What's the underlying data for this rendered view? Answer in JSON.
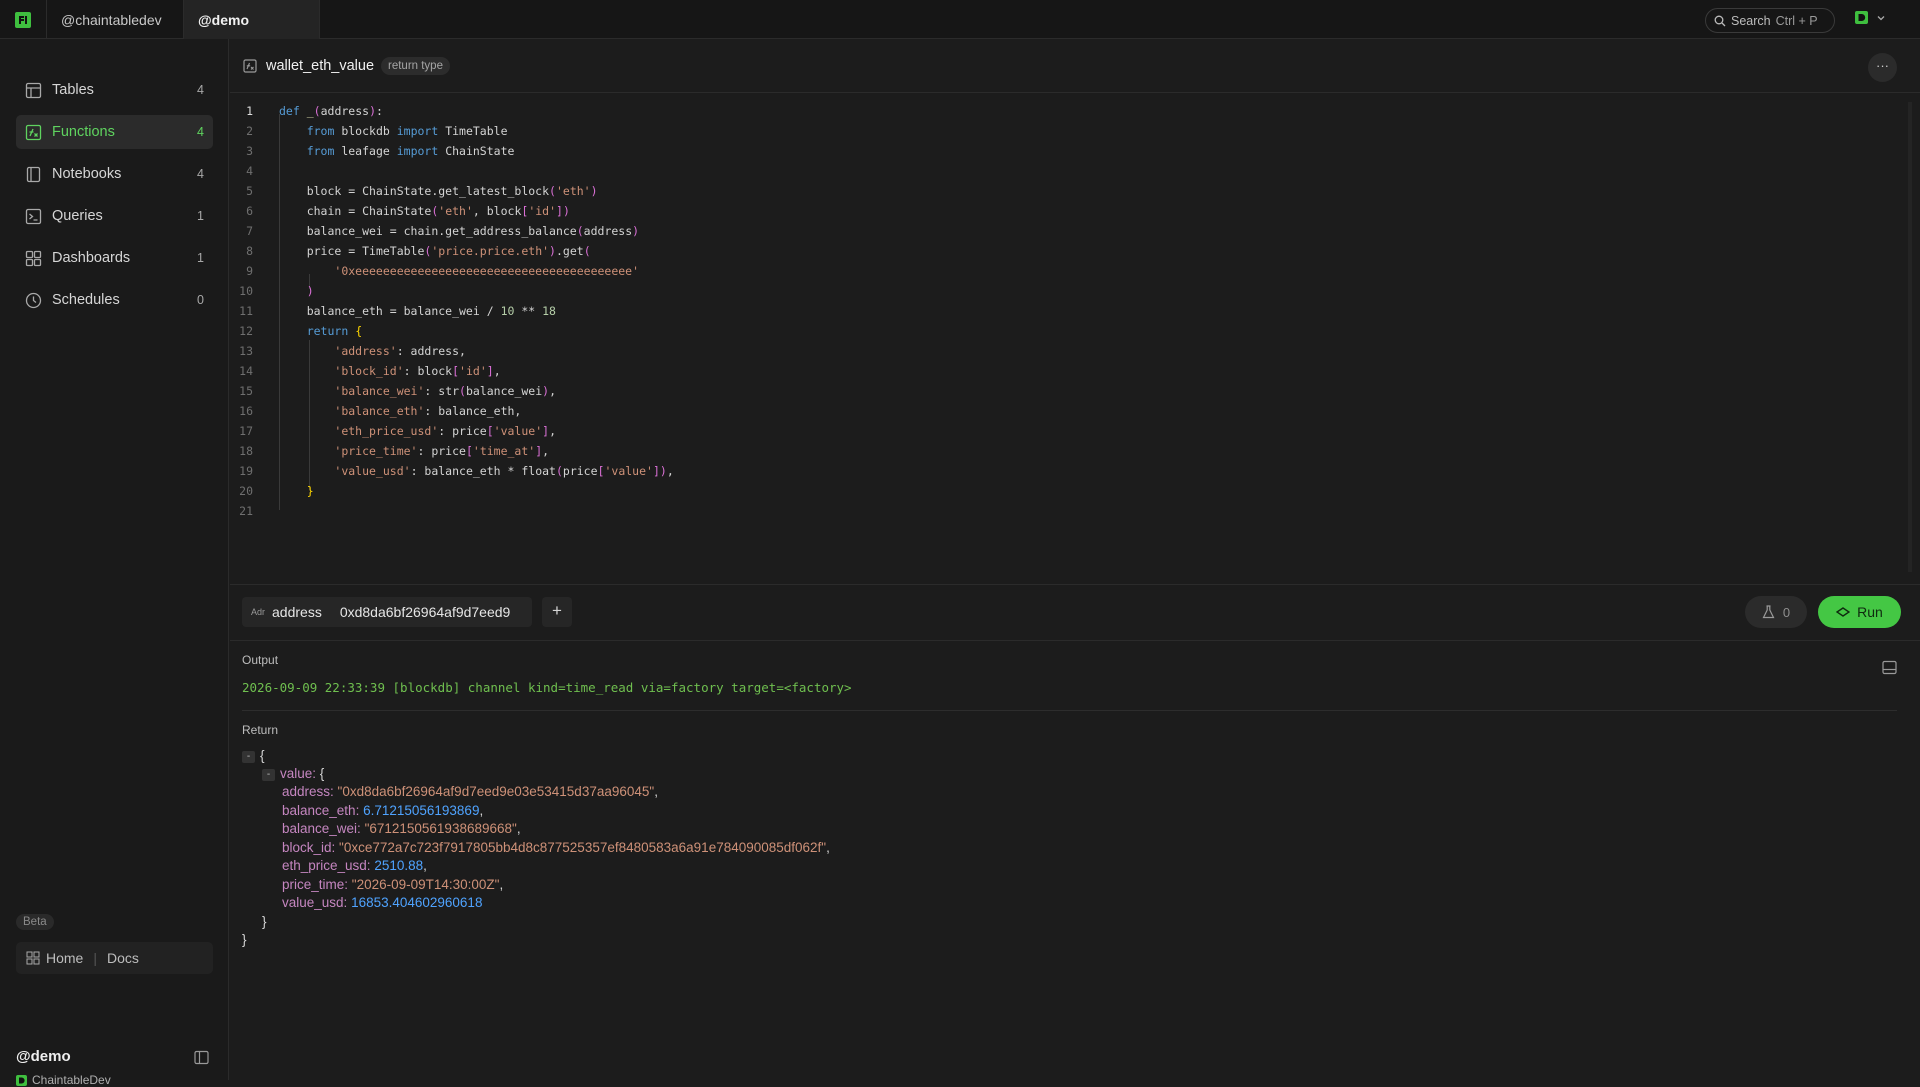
{
  "workspaces": [
    {
      "label": "@chaintabledev"
    },
    {
      "label": "@demo"
    }
  ],
  "search": {
    "label": "Search",
    "shortcut": "Ctrl + P"
  },
  "profile": {
    "initial": "D"
  },
  "sidebar": {
    "items": [
      {
        "label": "Tables",
        "count": "4",
        "icon": "table-icon"
      },
      {
        "label": "Functions",
        "count": "4",
        "icon": "function-icon",
        "active": true
      },
      {
        "label": "Notebooks",
        "count": "4",
        "icon": "notebook-icon"
      },
      {
        "label": "Queries",
        "count": "1",
        "icon": "terminal-icon"
      },
      {
        "label": "Dashboards",
        "count": "1",
        "icon": "dashboard-icon"
      },
      {
        "label": "Schedules",
        "count": "0",
        "icon": "clock-icon"
      }
    ],
    "beta": "Beta",
    "links": {
      "home": "Home",
      "docs": "Docs"
    },
    "account": {
      "name": "@demo",
      "org": "ChaintableDev"
    }
  },
  "function": {
    "name": "wallet_eth_value",
    "badge": "return type",
    "more": "···"
  },
  "editor": {
    "active_line": "1",
    "lines": [
      "def _(address):",
      "    from blockdb import TimeTable",
      "    from leafage import ChainState",
      "",
      "    block = ChainState.get_latest_block('eth')",
      "    chain = ChainState('eth', block['id'])",
      "    balance_wei = chain.get_address_balance(address)",
      "    price = TimeTable('price.price.eth').get(",
      "        '0xeeeeeeeeeeeeeeeeeeeeeeeeeeeeeeeeeeeeeeee'",
      "    )",
      "    balance_eth = balance_wei / 10 ** 18",
      "    return {",
      "        'address': address,",
      "        'block_id': block['id'],",
      "        'balance_wei': str(balance_wei),",
      "        'balance_eth': balance_eth,",
      "        'eth_price_usd': price['value'],",
      "        'price_time': price['time_at'],",
      "        'value_usd': balance_eth * float(price['value']),",
      "    }",
      ""
    ]
  },
  "params": {
    "tag": "Adr",
    "name": "address",
    "value": "0xd8da6bf26964af9d7eed9",
    "add": "+"
  },
  "actions": {
    "cost": "0",
    "run": "Run"
  },
  "output": {
    "label": "Output",
    "log": "2026-09-09 22:33:39 [blockdb] channel kind=time_read via=factory target=<factory>",
    "return_label": "Return",
    "value_key": "value",
    "fields": [
      {
        "key": "address",
        "value": "\"0xd8da6bf26964af9d7eed9e03e53415d37aa96045\"",
        "type": "string"
      },
      {
        "key": "balance_eth",
        "value": "6.71215056193869",
        "type": "number"
      },
      {
        "key": "balance_wei",
        "value": "\"6712150561938689668\"",
        "type": "string"
      },
      {
        "key": "block_id",
        "value": "\"0xce772a7c723f7917805bb4d8c877525357ef8480583a6a91e784090085df062f\"",
        "type": "string"
      },
      {
        "key": "eth_price_usd",
        "value": "2510.88",
        "type": "number"
      },
      {
        "key": "price_time",
        "value": "\"2026-09-09T14:30:00Z\"",
        "type": "string"
      },
      {
        "key": "value_usd",
        "value": "16853.404602960618",
        "type": "number"
      }
    ]
  },
  "colors": {
    "accent": "#44c744",
    "active_text": "#5fd35f",
    "background": "#1c1c1c",
    "sidebar": "#1a1a1a"
  }
}
